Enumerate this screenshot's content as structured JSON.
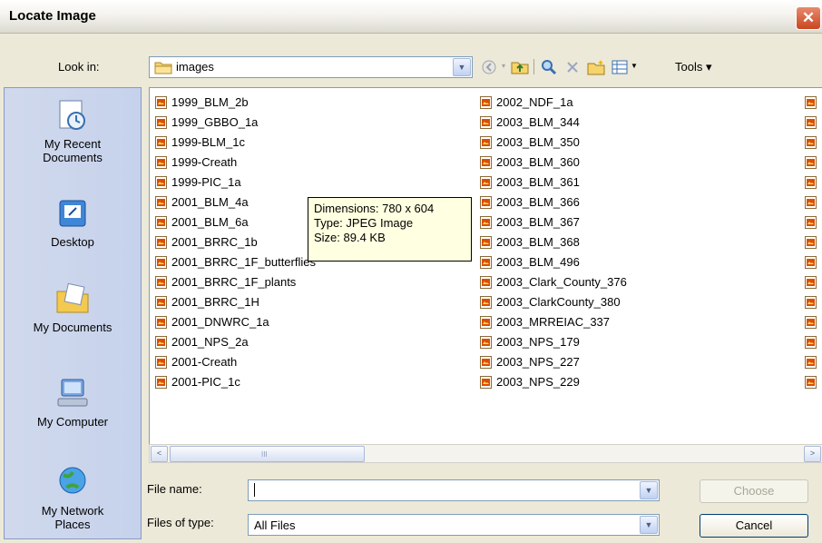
{
  "window": {
    "title": "Locate Image",
    "close_label": "✕"
  },
  "look_in": {
    "label": "Look in:",
    "value": "images"
  },
  "toolbar": {
    "tools_label": "Tools ▾"
  },
  "places": [
    {
      "label_line1": "My Recent",
      "label_line2": "Documents",
      "icon": "recent-documents-icon"
    },
    {
      "label_line1": "Desktop",
      "label_line2": "",
      "icon": "desktop-icon"
    },
    {
      "label_line1": "My Documents",
      "label_line2": "",
      "icon": "my-documents-icon"
    },
    {
      "label_line1": "My Computer",
      "label_line2": "",
      "icon": "my-computer-icon"
    },
    {
      "label_line1": "My Network",
      "label_line2": "Places",
      "icon": "network-places-icon"
    }
  ],
  "files_col1": [
    "1999_BLM_2b",
    "1999_GBBO_1a",
    "1999-BLM_1c",
    "1999-Creath",
    "1999-PIC_1a",
    "2001_BLM_4a",
    "2001_BLM_6a",
    "2001_BRRC_1b",
    "2001_BRRC_1F_butterflies",
    "2001_BRRC_1F_plants",
    "2001_BRRC_1H",
    "2001_DNWRC_1a",
    "2001_NPS_2a",
    "2001-Creath",
    "2001-PIC_1c"
  ],
  "files_col2": [
    "2002_NDF_1a",
    "2003_BLM_344",
    "2003_BLM_350",
    "2003_BLM_360",
    "2003_BLM_361",
    "2003_BLM_366",
    "2003_BLM_367",
    "2003_BLM_368",
    "2003_BLM_496",
    "2003_Clark_County_376",
    "2003_ClarkCounty_380",
    "2003_MRREIAC_337",
    "2003_NPS_179",
    "2003_NPS_227",
    "2003_NPS_229"
  ],
  "tooltip": {
    "line1": "Dimensions: 780 x 604",
    "line2": "Type: JPEG Image",
    "line3": "Size: 89.4 KB"
  },
  "file_name": {
    "label": "File name:",
    "value": ""
  },
  "file_type": {
    "label": "Files of type:",
    "value": "All Files"
  },
  "buttons": {
    "choose": "Choose",
    "cancel": "Cancel"
  },
  "scroll": {
    "left": "<",
    "right": ">",
    "grip": "III"
  },
  "colors": {
    "file_icon": "#d94f00",
    "tooltip_bg": "#ffffe1",
    "places_bg": "#c6d2ec"
  }
}
